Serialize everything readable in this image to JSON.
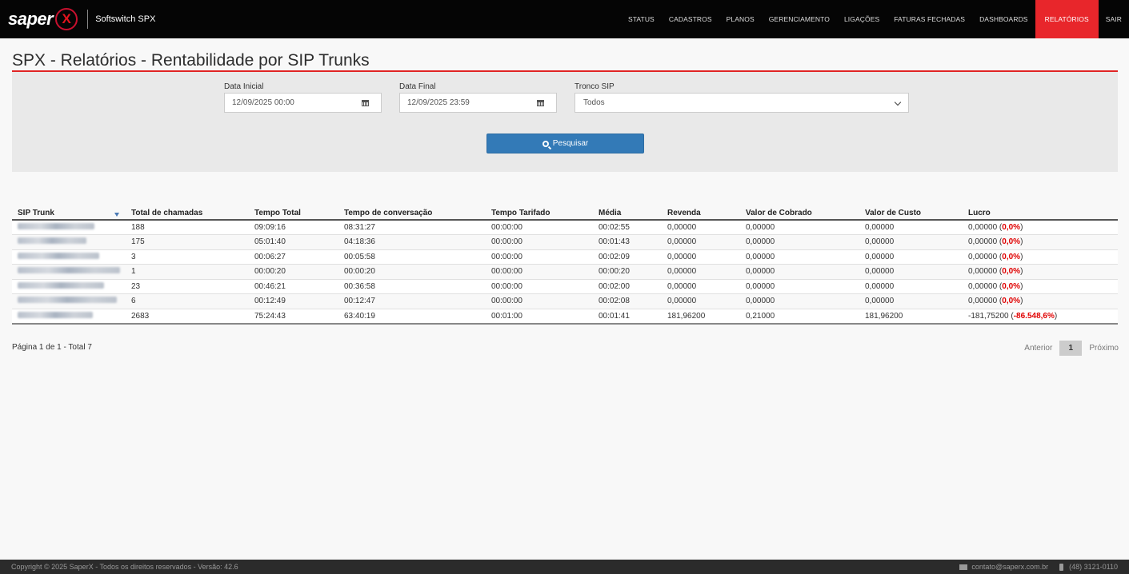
{
  "header": {
    "logo_text": "saper",
    "logo_mark": "X",
    "product": "Softswitch SPX",
    "nav": [
      "STATUS",
      "CADASTROS",
      "PLANOS",
      "GERENCIAMENTO",
      "LIGAÇÕES",
      "FATURAS FECHADAS",
      "DASHBOARDS",
      "RELATÓRIOS",
      "SAIR"
    ],
    "active_nav": "RELATÓRIOS"
  },
  "page": {
    "title": "SPX - Relatórios - Rentabilidade por SIP Trunks"
  },
  "filters": {
    "start_label": "Data Inicial",
    "start_value": "12/09/2025 00:00",
    "end_label": "Data Final",
    "end_value": "12/09/2025 23:59",
    "trunk_label": "Tronco SIP",
    "trunk_value": "Todos",
    "search_label": "Pesquisar",
    "calendar_icon": "calendar-icon",
    "search_icon": "search-icon"
  },
  "table": {
    "headers": [
      "SIP Trunk",
      "Total de chamadas",
      "Tempo Total",
      "Tempo de conversação",
      "Tempo Tarifado",
      "Média",
      "Revenda",
      "Valor de Cobrado",
      "Valor de Custo",
      "Lucro"
    ],
    "rows": [
      {
        "calls": "188",
        "total": "09:09:16",
        "conv": "08:31:27",
        "tarif": "00:00:00",
        "avg": "00:02:55",
        "revenda": "0,00000",
        "cobrado": "0,00000",
        "custo": "0,00000",
        "lucro": "0,00000 (",
        "lucro_pct": "0,0%",
        "lucro_end": ")"
      },
      {
        "calls": "175",
        "total": "05:01:40",
        "conv": "04:18:36",
        "tarif": "00:00:00",
        "avg": "00:01:43",
        "revenda": "0,00000",
        "cobrado": "0,00000",
        "custo": "0,00000",
        "lucro": "0,00000 (",
        "lucro_pct": "0,0%",
        "lucro_end": ")"
      },
      {
        "calls": "3",
        "total": "00:06:27",
        "conv": "00:05:58",
        "tarif": "00:00:00",
        "avg": "00:02:09",
        "revenda": "0,00000",
        "cobrado": "0,00000",
        "custo": "0,00000",
        "lucro": "0,00000 (",
        "lucro_pct": "0,0%",
        "lucro_end": ")"
      },
      {
        "calls": "1",
        "total": "00:00:20",
        "conv": "00:00:20",
        "tarif": "00:00:00",
        "avg": "00:00:20",
        "revenda": "0,00000",
        "cobrado": "0,00000",
        "custo": "0,00000",
        "lucro": "0,00000 (",
        "lucro_pct": "0,0%",
        "lucro_end": ")"
      },
      {
        "calls": "23",
        "total": "00:46:21",
        "conv": "00:36:58",
        "tarif": "00:00:00",
        "avg": "00:02:00",
        "revenda": "0,00000",
        "cobrado": "0,00000",
        "custo": "0,00000",
        "lucro": "0,00000 (",
        "lucro_pct": "0,0%",
        "lucro_end": ")"
      },
      {
        "calls": "6",
        "total": "00:12:49",
        "conv": "00:12:47",
        "tarif": "00:00:00",
        "avg": "00:02:08",
        "revenda": "0,00000",
        "cobrado": "0,00000",
        "custo": "0,00000",
        "lucro": "0,00000 (",
        "lucro_pct": "0,0%",
        "lucro_end": ")"
      },
      {
        "calls": "2683",
        "total": "75:24:43",
        "conv": "63:40:19",
        "tarif": "00:01:00",
        "avg": "00:01:41",
        "revenda": "181,96200",
        "cobrado": "0,21000",
        "custo": "181,96200",
        "lucro": "-181,75200 (",
        "lucro_pct": "-86.548,6%",
        "lucro_end": ")"
      }
    ]
  },
  "pagination": {
    "info": "Página 1 de 1 - Total 7",
    "prev": "Anterior",
    "current": "1",
    "next": "Próximo"
  },
  "footer": {
    "copyright": "Copyright © 2025 SaperX - Todos os direitos reservados - Versão: 42.6",
    "email": "contato@saperx.com.br",
    "phone": "(48) 3121-0110",
    "email_icon": "envelope-icon",
    "phone_icon": "phone-icon"
  },
  "colors": {
    "accent": "#e8262b",
    "primary_button": "#337ab7",
    "negative": "#e00000",
    "topbar": "#050505"
  }
}
